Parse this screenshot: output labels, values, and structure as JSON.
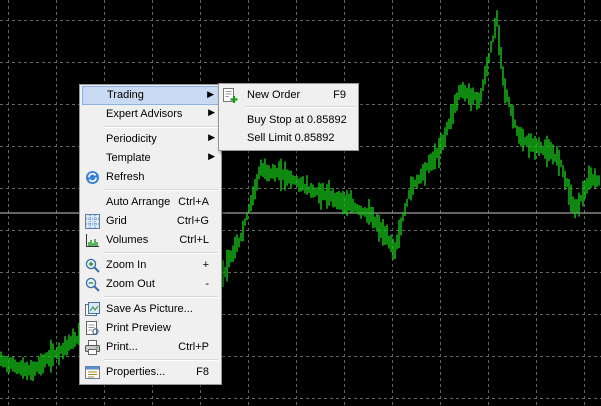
{
  "colors": {
    "background": "#000000",
    "grid": "#5f6b5f",
    "candle": "#16c416",
    "crosshair": "#c8c8c8",
    "menu_bg": "#f0f0f0",
    "highlight": "#c9daf4"
  },
  "context_menu": {
    "trading": {
      "label": "Trading"
    },
    "expert_advisors": {
      "label": "Expert Advisors"
    },
    "periodicity": {
      "label": "Periodicity"
    },
    "template": {
      "label": "Template"
    },
    "refresh": {
      "label": "Refresh",
      "icon": "refresh-icon"
    },
    "auto_arrange": {
      "label": "Auto Arrange",
      "shortcut": "Ctrl+A"
    },
    "grid": {
      "label": "Grid",
      "shortcut": "Ctrl+G",
      "icon": "grid-icon"
    },
    "volumes": {
      "label": "Volumes",
      "shortcut": "Ctrl+L",
      "icon": "volumes-icon"
    },
    "zoom_in": {
      "label": "Zoom In",
      "shortcut": "+",
      "icon": "zoom-in-icon"
    },
    "zoom_out": {
      "label": "Zoom Out",
      "shortcut": "-",
      "icon": "zoom-out-icon"
    },
    "save_as_picture": {
      "label": "Save As Picture...",
      "icon": "save-picture-icon"
    },
    "print_preview": {
      "label": "Print Preview",
      "icon": "print-preview-icon"
    },
    "print": {
      "label": "Print...",
      "shortcut": "Ctrl+P",
      "icon": "printer-icon"
    },
    "properties": {
      "label": "Properties...",
      "shortcut": "F8",
      "icon": "properties-icon"
    }
  },
  "trading_submenu": {
    "new_order": {
      "label": "New Order",
      "shortcut": "F9",
      "icon": "new-order-icon"
    },
    "buy_stop": {
      "label": "Buy Stop at 0.85892"
    },
    "sell_limit": {
      "label": "Sell Limit 0.85892"
    }
  }
}
